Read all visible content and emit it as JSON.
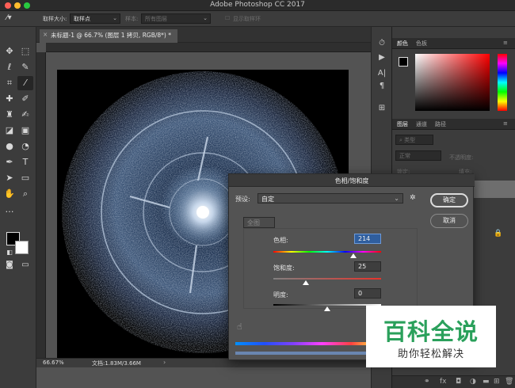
{
  "window": {
    "title": "Adobe Photoshop CC 2017"
  },
  "options_bar": {
    "sample_size_label": "取样大小:",
    "sample_size_value": "取样点",
    "sample_label": "样本:",
    "sample_value": "所有图层",
    "show_ring_label": "显示取样环"
  },
  "document": {
    "tab_title": "未标题-1 @ 66.7% (图层 1 拷贝, RGB/8*) *",
    "zoom": "66.67%",
    "doc_size": "文档:1.83M/3.66M"
  },
  "panels": {
    "color_tabs": [
      "颜色",
      "色板"
    ],
    "layer_tabs": [
      "图层",
      "通道",
      "路径"
    ],
    "kind_filter": "类型",
    "blend_mode": "正常",
    "opacity_label": "不透明度:",
    "lock_label": "锁定:",
    "fill_label": "填充:"
  },
  "dialog": {
    "title": "色相/饱和度",
    "preset_label": "预设:",
    "preset_value": "自定",
    "channel": "全图",
    "hue_label": "色相:",
    "hue_value": "214",
    "saturation_label": "饱和度:",
    "saturation_value": "25",
    "lightness_label": "明度:",
    "lightness_value": "0",
    "ok_label": "确定",
    "cancel_label": "取消",
    "hue_fraction": 0.74,
    "saturation_fraction": 0.3,
    "lightness_fraction": 0.5
  },
  "watermark": {
    "title": "百科全说",
    "subtitle": "助你轻松解决"
  },
  "colors": {
    "foreground": "#000000",
    "background": "#ffffff",
    "accent_green": "#2aa05b"
  }
}
